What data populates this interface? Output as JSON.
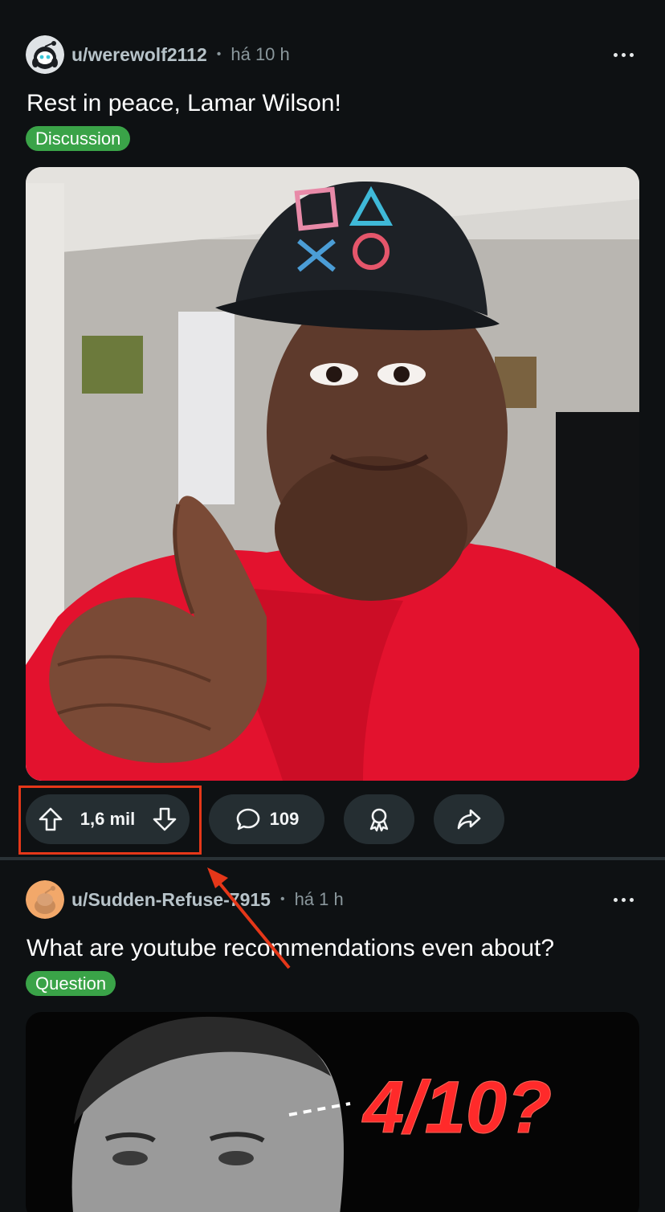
{
  "posts": [
    {
      "username": "u/werewolf2112",
      "time": "há 10 h",
      "title": "Rest in peace, Lamar Wilson!",
      "flair": "Discussion",
      "flair_color": "#3aa348",
      "votes": "1,6 mil",
      "comments": "109"
    },
    {
      "username": "u/Sudden-Refuse-7915",
      "time": "há 1 h",
      "title": "What are youtube recommendations even about?",
      "flair": "Question",
      "flair_color": "#3aa348",
      "thumbnail_text": "4/10?"
    }
  ],
  "icons": {
    "more": "more-options-icon",
    "upvote": "upvote-arrow-icon",
    "downvote": "downvote-arrow-icon",
    "comment": "comment-bubble-icon",
    "award": "award-icon",
    "share": "share-icon"
  },
  "annotation": {
    "highlight_color": "#e53719",
    "target": "vote-pill"
  }
}
